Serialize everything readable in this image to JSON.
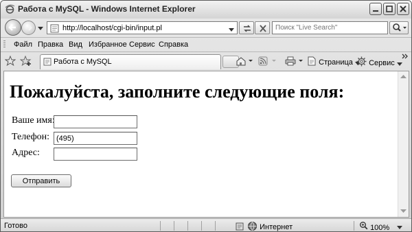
{
  "window": {
    "title": "Работа с MySQL - Windows Internet Explorer"
  },
  "address_bar": {
    "url": "http://localhost/cgi-bin/input.pl"
  },
  "search": {
    "placeholder": "Поиск \"Live Search\""
  },
  "menu": {
    "items": [
      {
        "label": "Файл"
      },
      {
        "label": "Правка"
      },
      {
        "label": "Вид"
      },
      {
        "label": "Избранное"
      },
      {
        "label": "Сервис"
      },
      {
        "label": "Справка"
      }
    ]
  },
  "tab": {
    "label": "Работа с MySQL"
  },
  "command_bar": {
    "page_label": "Страница",
    "tools_label": "Сервис"
  },
  "page": {
    "heading": "Пожалуйста, заполните следующие поля:",
    "fields": [
      {
        "label": "Ваше имя:",
        "value": ""
      },
      {
        "label": "Телефон:",
        "value": "(495)"
      },
      {
        "label": "Адрес:",
        "value": ""
      }
    ],
    "submit_label": "Отправить"
  },
  "status_bar": {
    "status": "Готово",
    "zone": "Интернет",
    "zoom": "100%"
  }
}
